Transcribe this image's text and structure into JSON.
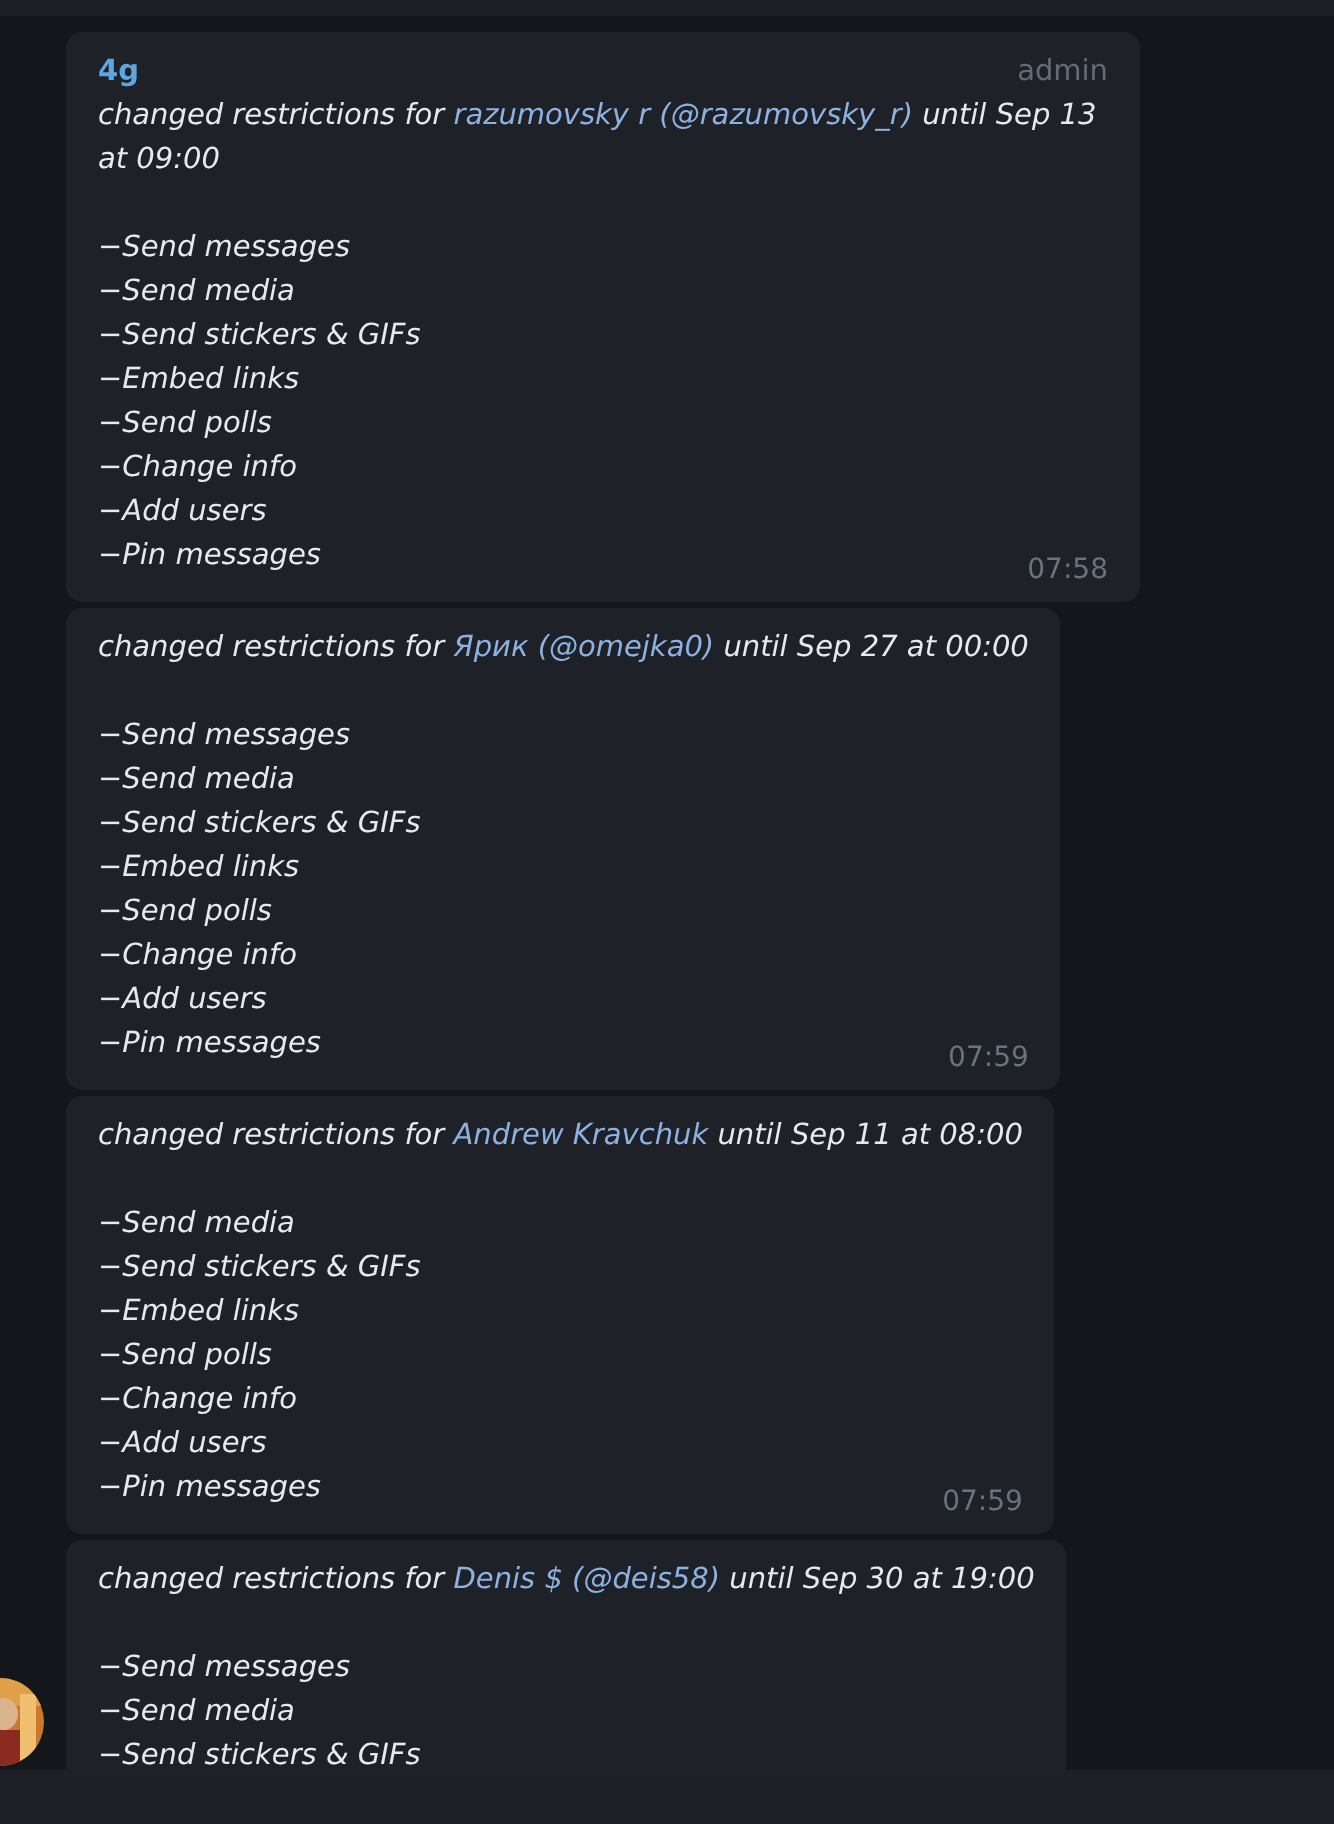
{
  "messages": [
    {
      "sender": "4g",
      "role": "admin",
      "text": [
        {
          "kind": "plain",
          "text": "changed restrictions for "
        },
        {
          "kind": "link",
          "text": "razumovsky r (@razumovsky_r)"
        },
        {
          "kind": "plain",
          "text": " until Sep 13 at 09:00"
        }
      ],
      "restrictions": [
        "−Send messages",
        "−Send media",
        "−Send stickers & GIFs",
        "−Embed links",
        "−Send polls",
        "−Change info",
        "−Add users",
        "−Pin messages"
      ],
      "time": "07:58"
    },
    {
      "text": [
        {
          "kind": "plain",
          "text": "changed restrictions for "
        },
        {
          "kind": "link",
          "text": "Ярик (@omejka0)"
        },
        {
          "kind": "plain",
          "text": " until Sep 27 at 00:00"
        }
      ],
      "restrictions": [
        "−Send messages",
        "−Send media",
        "−Send stickers & GIFs",
        "−Embed links",
        "−Send polls",
        "−Change info",
        "−Add users",
        "−Pin messages"
      ],
      "time": "07:59"
    },
    {
      "text": [
        {
          "kind": "plain",
          "text": "changed restrictions for "
        },
        {
          "kind": "link",
          "text": "Andrew Kravchuk"
        },
        {
          "kind": "plain",
          "text": " until Sep 11 at 08:00"
        }
      ],
      "restrictions": [
        "−Send media",
        "−Send stickers & GIFs",
        "−Embed links",
        "−Send polls",
        "−Change info",
        "−Add users",
        "−Pin messages"
      ],
      "time": "07:59"
    },
    {
      "avatar": {
        "kind": "picture"
      },
      "text": [
        {
          "kind": "plain",
          "text": "changed restrictions for "
        },
        {
          "kind": "link",
          "text": "Denis $ (@deis58)"
        },
        {
          "kind": "plain",
          "text": " until Sep 30 at 19:00"
        }
      ],
      "restrictions": [
        "−Send messages",
        "−Send media",
        "−Send stickers & GIFs"
      ]
    }
  ]
}
